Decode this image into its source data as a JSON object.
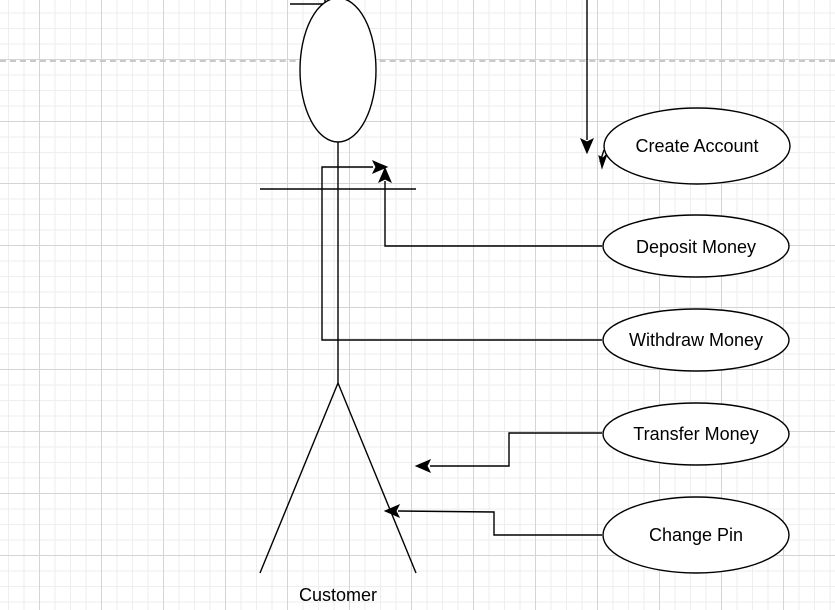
{
  "diagram": {
    "actor": {
      "label": "Customer"
    },
    "use_cases": [
      {
        "id": "create-account",
        "label": "Create Account"
      },
      {
        "id": "deposit-money",
        "label": "Deposit Money"
      },
      {
        "id": "withdraw-money",
        "label": "Withdraw Money"
      },
      {
        "id": "transfer-money",
        "label": "Transfer Money"
      },
      {
        "id": "change-pin",
        "label": "Change Pin"
      }
    ]
  },
  "colors": {
    "stroke": "#000000",
    "fill": "#ffffff",
    "grid": "#d4d4d4",
    "page_break": "#c8c8c8"
  }
}
